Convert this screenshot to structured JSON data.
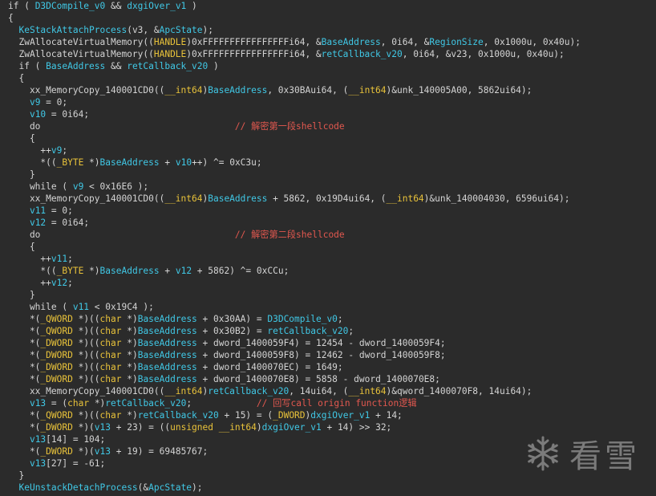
{
  "editor": {
    "lines": [
      [
        [
          "plain",
          "if ( "
        ],
        [
          "var",
          "D3DCompile_v0"
        ],
        [
          "plain",
          " && "
        ],
        [
          "var",
          "dxgiOver_v1"
        ],
        [
          "plain",
          " )"
        ]
      ],
      [
        [
          "plain",
          "{"
        ]
      ],
      [
        [
          "plain",
          "  "
        ],
        [
          "func",
          "KeStackAttachProcess"
        ],
        [
          "plain",
          "(v3, &"
        ],
        [
          "var",
          "ApcState"
        ],
        [
          "plain",
          ");"
        ]
      ],
      [
        [
          "plain",
          "  ZwAllocateVirtualMemory(("
        ],
        [
          "type",
          "HANDLE"
        ],
        [
          "plain",
          ")0xFFFFFFFFFFFFFFFFi64, &"
        ],
        [
          "var",
          "BaseAddress"
        ],
        [
          "plain",
          ", 0i64, &"
        ],
        [
          "var",
          "RegionSize"
        ],
        [
          "plain",
          ", 0x1000u, 0x40u);"
        ]
      ],
      [
        [
          "plain",
          "  ZwAllocateVirtualMemory(("
        ],
        [
          "type",
          "HANDLE"
        ],
        [
          "plain",
          ")0xFFFFFFFFFFFFFFFFi64, &"
        ],
        [
          "var",
          "retCallback_v20"
        ],
        [
          "plain",
          ", 0i64, &v23, 0x1000u, 0x40u);"
        ]
      ],
      [
        [
          "plain",
          "  if ( "
        ],
        [
          "var",
          "BaseAddress"
        ],
        [
          "plain",
          " && "
        ],
        [
          "var",
          "retCallback_v20"
        ],
        [
          "plain",
          " )"
        ]
      ],
      [
        [
          "plain",
          "  {"
        ]
      ],
      [
        [
          "plain",
          "    xx_MemoryCopy_140001CD0(("
        ],
        [
          "type",
          "__int64"
        ],
        [
          "plain",
          ")"
        ],
        [
          "var",
          "BaseAddress"
        ],
        [
          "plain",
          ", 0x30BAui64, ("
        ],
        [
          "type",
          "__int64"
        ],
        [
          "plain",
          ")&unk_140005A00, 5862ui64);"
        ]
      ],
      [
        [
          "plain",
          "    "
        ],
        [
          "var",
          "v9"
        ],
        [
          "plain",
          " = 0;"
        ]
      ],
      [
        [
          "plain",
          "    "
        ],
        [
          "var",
          "v10"
        ],
        [
          "plain",
          " = 0i64;"
        ]
      ],
      [
        [
          "plain",
          "    do                                    "
        ],
        [
          "comment",
          "// 解密第一段shellcode"
        ]
      ],
      [
        [
          "plain",
          "    {"
        ]
      ],
      [
        [
          "plain",
          "      ++"
        ],
        [
          "var",
          "v9"
        ],
        [
          "plain",
          ";"
        ]
      ],
      [
        [
          "plain",
          "      *(("
        ],
        [
          "type",
          "_BYTE"
        ],
        [
          "plain",
          " *)"
        ],
        [
          "var",
          "BaseAddress"
        ],
        [
          "plain",
          " + "
        ],
        [
          "var",
          "v10"
        ],
        [
          "plain",
          "++) ^= 0xC3u;"
        ]
      ],
      [
        [
          "plain",
          "    }"
        ]
      ],
      [
        [
          "plain",
          "    while ( "
        ],
        [
          "var",
          "v9"
        ],
        [
          "plain",
          " < 0x16E6 );"
        ]
      ],
      [
        [
          "plain",
          "    xx_MemoryCopy_140001CD0(("
        ],
        [
          "type",
          "__int64"
        ],
        [
          "plain",
          ")"
        ],
        [
          "var",
          "BaseAddress"
        ],
        [
          "plain",
          " + 5862, 0x19D4ui64, ("
        ],
        [
          "type",
          "__int64"
        ],
        [
          "plain",
          ")&unk_140004030, 6596ui64);"
        ]
      ],
      [
        [
          "plain",
          "    "
        ],
        [
          "var",
          "v11"
        ],
        [
          "plain",
          " = 0;"
        ]
      ],
      [
        [
          "plain",
          "    "
        ],
        [
          "var",
          "v12"
        ],
        [
          "plain",
          " = 0i64;"
        ]
      ],
      [
        [
          "plain",
          "    do                                    "
        ],
        [
          "comment",
          "// 解密第二段shellcode"
        ]
      ],
      [
        [
          "plain",
          "    {"
        ]
      ],
      [
        [
          "plain",
          "      ++"
        ],
        [
          "var",
          "v11"
        ],
        [
          "plain",
          ";"
        ]
      ],
      [
        [
          "plain",
          "      *(("
        ],
        [
          "type",
          "_BYTE"
        ],
        [
          "plain",
          " *)"
        ],
        [
          "var",
          "BaseAddress"
        ],
        [
          "plain",
          " + "
        ],
        [
          "var",
          "v12"
        ],
        [
          "plain",
          " + 5862) ^= 0xCCu;"
        ]
      ],
      [
        [
          "plain",
          "      ++"
        ],
        [
          "var",
          "v12"
        ],
        [
          "plain",
          ";"
        ]
      ],
      [
        [
          "plain",
          "    }"
        ]
      ],
      [
        [
          "plain",
          "    while ( "
        ],
        [
          "var",
          "v11"
        ],
        [
          "plain",
          " < 0x19C4 );"
        ]
      ],
      [
        [
          "plain",
          "    *("
        ],
        [
          "type",
          "_QWORD"
        ],
        [
          "plain",
          " *)(("
        ],
        [
          "type",
          "char"
        ],
        [
          "plain",
          " *)"
        ],
        [
          "var",
          "BaseAddress"
        ],
        [
          "plain",
          " + 0x30AA) = "
        ],
        [
          "var",
          "D3DCompile_v0"
        ],
        [
          "plain",
          ";"
        ]
      ],
      [
        [
          "plain",
          "    *("
        ],
        [
          "type",
          "_QWORD"
        ],
        [
          "plain",
          " *)(("
        ],
        [
          "type",
          "char"
        ],
        [
          "plain",
          " *)"
        ],
        [
          "var",
          "BaseAddress"
        ],
        [
          "plain",
          " + 0x30B2) = "
        ],
        [
          "var",
          "retCallback_v20"
        ],
        [
          "plain",
          ";"
        ]
      ],
      [
        [
          "plain",
          "    *("
        ],
        [
          "type",
          "_DWORD"
        ],
        [
          "plain",
          " *)(("
        ],
        [
          "type",
          "char"
        ],
        [
          "plain",
          " *)"
        ],
        [
          "var",
          "BaseAddress"
        ],
        [
          "plain",
          " + dword_1400059F4) = 12454 - dword_1400059F4;"
        ]
      ],
      [
        [
          "plain",
          "    *("
        ],
        [
          "type",
          "_DWORD"
        ],
        [
          "plain",
          " *)(("
        ],
        [
          "type",
          "char"
        ],
        [
          "plain",
          " *)"
        ],
        [
          "var",
          "BaseAddress"
        ],
        [
          "plain",
          " + dword_1400059F8) = 12462 - dword_1400059F8;"
        ]
      ],
      [
        [
          "plain",
          "    *("
        ],
        [
          "type",
          "_DWORD"
        ],
        [
          "plain",
          " *)(("
        ],
        [
          "type",
          "char"
        ],
        [
          "plain",
          " *)"
        ],
        [
          "var",
          "BaseAddress"
        ],
        [
          "plain",
          " + dword_1400070EC) = 1649;"
        ]
      ],
      [
        [
          "plain",
          "    *("
        ],
        [
          "type",
          "_DWORD"
        ],
        [
          "plain",
          " *)(("
        ],
        [
          "type",
          "char"
        ],
        [
          "plain",
          " *)"
        ],
        [
          "var",
          "BaseAddress"
        ],
        [
          "plain",
          " + dword_1400070E8) = 5858 - dword_1400070E8;"
        ]
      ],
      [
        [
          "plain",
          "    xx_MemoryCopy_140001CD0(("
        ],
        [
          "type",
          "__int64"
        ],
        [
          "plain",
          ")"
        ],
        [
          "var",
          "retCallback_v20"
        ],
        [
          "plain",
          ", 14ui64, ("
        ],
        [
          "type",
          "__int64"
        ],
        [
          "plain",
          ")&qword_1400070F8, 14ui64);"
        ]
      ],
      [
        [
          "plain",
          "    "
        ],
        [
          "var",
          "v13"
        ],
        [
          "plain",
          " = ("
        ],
        [
          "type",
          "char"
        ],
        [
          "plain",
          " *)"
        ],
        [
          "var",
          "retCallback_v20"
        ],
        [
          "plain",
          ";            "
        ],
        [
          "comment",
          "// 回写call origin function逻辑"
        ]
      ],
      [
        [
          "plain",
          "    *("
        ],
        [
          "type",
          "_QWORD"
        ],
        [
          "plain",
          " *)(("
        ],
        [
          "type",
          "char"
        ],
        [
          "plain",
          " *)"
        ],
        [
          "var",
          "retCallback_v20"
        ],
        [
          "plain",
          " + 15) = ("
        ],
        [
          "type",
          "_DWORD"
        ],
        [
          "plain",
          ")"
        ],
        [
          "var",
          "dxgiOver_v1"
        ],
        [
          "plain",
          " + 14;"
        ]
      ],
      [
        [
          "plain",
          "    *("
        ],
        [
          "type",
          "_DWORD"
        ],
        [
          "plain",
          " *)("
        ],
        [
          "var",
          "v13"
        ],
        [
          "plain",
          " + 23) = (("
        ],
        [
          "type",
          "unsigned __int64"
        ],
        [
          "plain",
          ")"
        ],
        [
          "var",
          "dxgiOver_v1"
        ],
        [
          "plain",
          " + 14) >> 32;"
        ]
      ],
      [
        [
          "plain",
          "    "
        ],
        [
          "var",
          "v13"
        ],
        [
          "plain",
          "[14] = 104;"
        ]
      ],
      [
        [
          "plain",
          "    *("
        ],
        [
          "type",
          "_DWORD"
        ],
        [
          "plain",
          " *)("
        ],
        [
          "var",
          "v13"
        ],
        [
          "plain",
          " + 19) = 69485767;"
        ]
      ],
      [
        [
          "plain",
          "    "
        ],
        [
          "var",
          "v13"
        ],
        [
          "plain",
          "[27] = -61;"
        ]
      ],
      [
        [
          "plain",
          "  }"
        ]
      ],
      [
        [
          "plain",
          "  "
        ],
        [
          "func",
          "KeUnstackDetachProcess"
        ],
        [
          "plain",
          "(&"
        ],
        [
          "var",
          "ApcState"
        ],
        [
          "plain",
          ");"
        ]
      ]
    ]
  },
  "watermark": {
    "text": "看雪",
    "icon": "snowflake-icon"
  },
  "colors": {
    "background": "#2b2b2b",
    "plain": "#d4d4d4",
    "variable": "#40c8e6",
    "type": "#e8c23a",
    "comment": "#e2584f"
  }
}
